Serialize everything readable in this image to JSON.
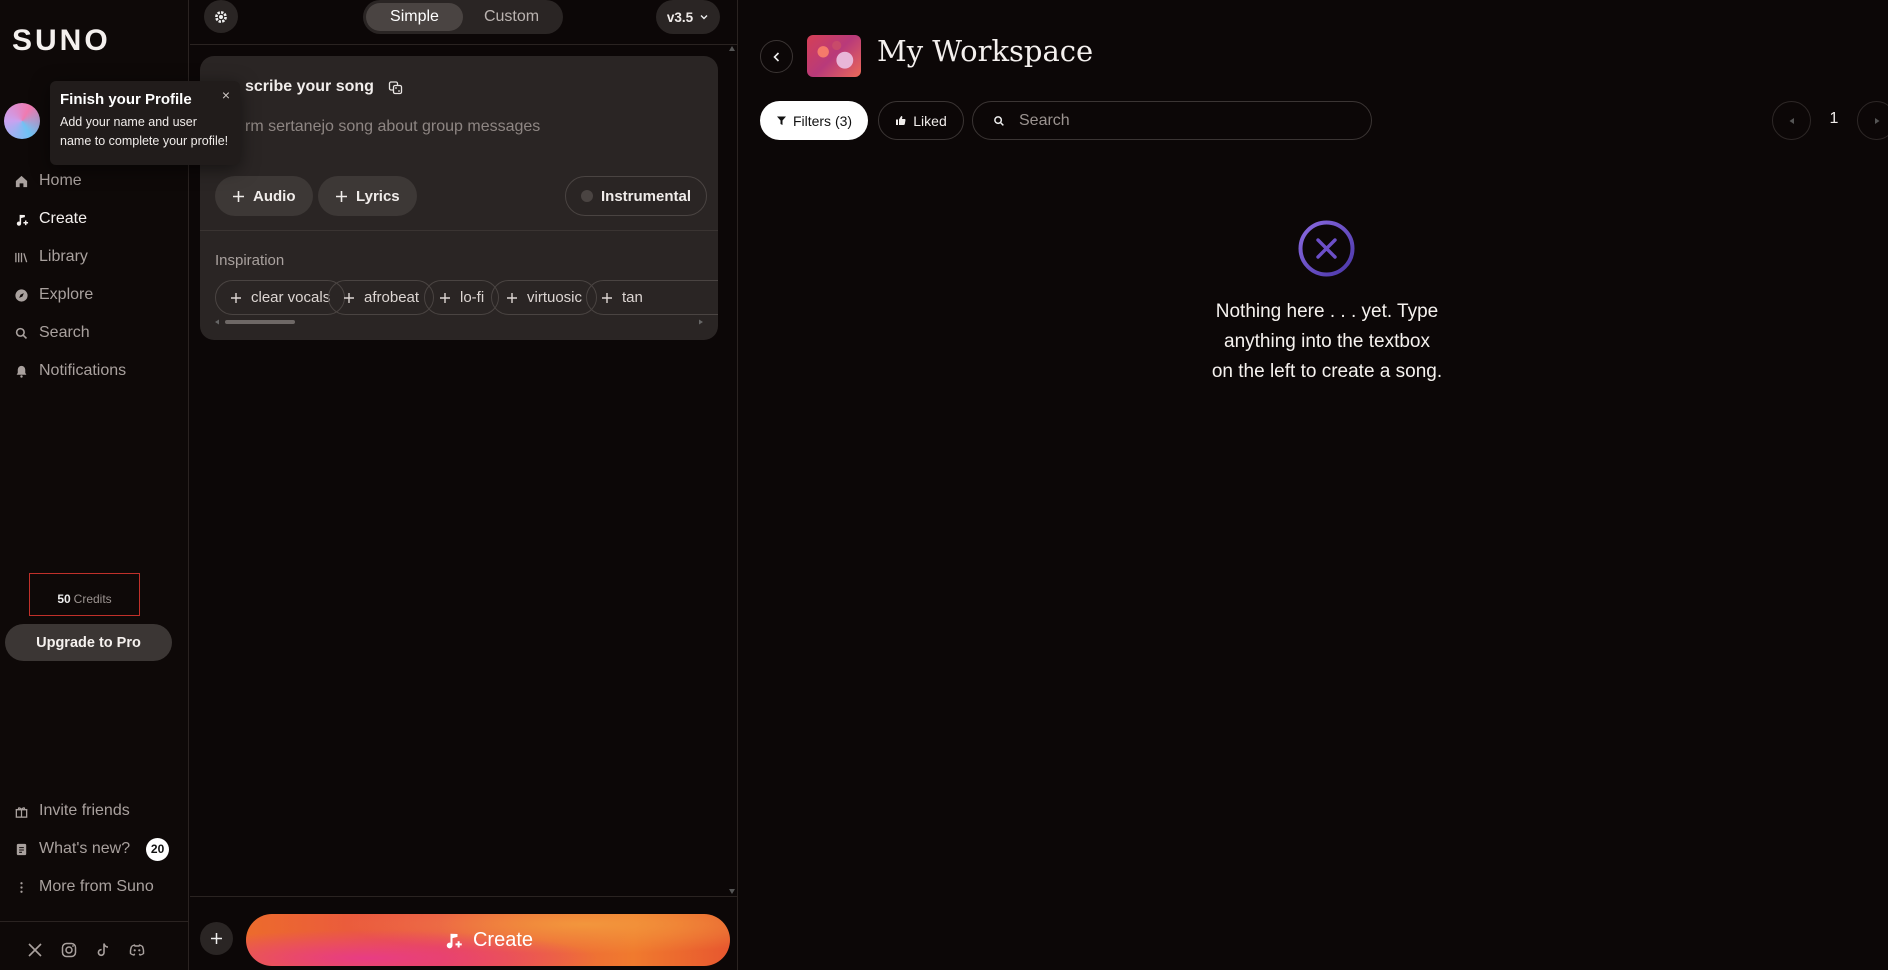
{
  "sidebar": {
    "logo": "SUNO",
    "nav": [
      {
        "label": "Home",
        "icon": "home-icon"
      },
      {
        "label": "Create",
        "icon": "music-note-plus-icon"
      },
      {
        "label": "Library",
        "icon": "library-icon"
      },
      {
        "label": "Explore",
        "icon": "compass-icon"
      },
      {
        "label": "Search",
        "icon": "search-icon"
      },
      {
        "label": "Notifications",
        "icon": "bell-icon"
      }
    ],
    "credits_count": "50",
    "credits_label": "Credits",
    "upgrade_label": "Upgrade to Pro",
    "bottom": [
      {
        "label": "Invite friends",
        "icon": "gift-icon"
      },
      {
        "label": "What's new?",
        "icon": "document-icon",
        "badge": "20"
      },
      {
        "label": "More from Suno",
        "icon": "more-vertical-icon"
      }
    ],
    "social": [
      "x-icon",
      "instagram-icon",
      "tiktok-icon",
      "discord-icon"
    ]
  },
  "tooltip": {
    "title": "Finish your Profile",
    "body": "Add your name and user name to complete your profile!",
    "close": "×"
  },
  "create": {
    "modes": [
      "Simple",
      "Custom"
    ],
    "selected_mode": "Simple",
    "version": "v3.5",
    "card_title": "scribe your song",
    "prompt_placeholder": "rm sertanejo song about group messages",
    "chips": [
      "Audio",
      "Lyrics"
    ],
    "instrumental_label": "Instrumental",
    "inspiration_label": "Inspiration",
    "inspiration_tags": [
      "clear vocals",
      "afrobeat",
      "lo-fi",
      "virtuosic",
      "tan"
    ],
    "create_label": "Create"
  },
  "workspace": {
    "title": "My Workspace",
    "filters_label": "Filters (3)",
    "liked_label": "Liked",
    "search_placeholder": "Search",
    "page": "1",
    "empty_lines": [
      "Nothing here . . . yet. Type",
      "anything into the textbox",
      "on the left to create a song."
    ]
  },
  "colors": {
    "background": "#0c0707",
    "card": "#2a2524",
    "accent_orange": "#ec6b2c",
    "accent_pink": "#e83c84",
    "empty_icon": "#6c4fc8"
  }
}
